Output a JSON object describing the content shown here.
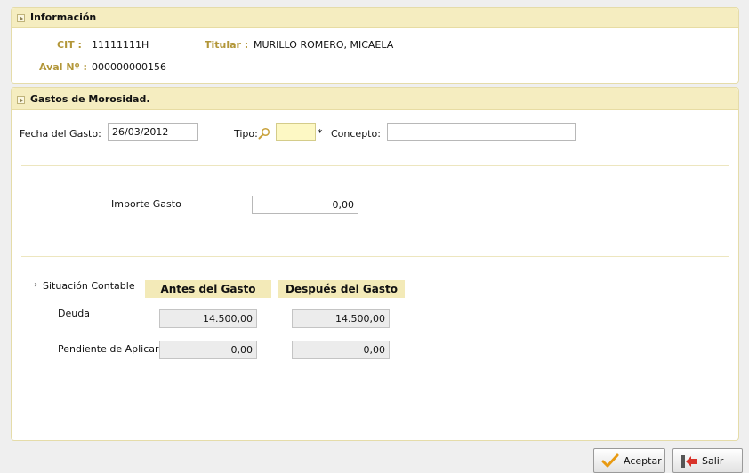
{
  "informacion": {
    "title": "Información",
    "cit_label": "CIT :",
    "cit_value": "11111111H",
    "titular_label": "Titular :",
    "titular_value": "MURILLO ROMERO, MICAELA",
    "aval_label": "Aval Nº :",
    "aval_value": "000000000156"
  },
  "gastos": {
    "title": "Gastos de Morosidad.",
    "fecha_label": "Fecha del Gasto:",
    "fecha_value": "26/03/2012",
    "tipo_label": "Tipo:",
    "tipo_value": "",
    "required_mark": "*",
    "concepto_label": "Concepto:",
    "concepto_value": "",
    "importe_label": "Importe Gasto",
    "importe_value": "0,00"
  },
  "situacion": {
    "label": "Situación Contable",
    "bullet": "›",
    "col_antes": "Antes del Gasto",
    "col_despues": "Después del Gasto",
    "rows": [
      {
        "label": "Deuda",
        "antes": "14.500,00",
        "despues": "14.500,00"
      },
      {
        "label": "Pendiente de Aplicar",
        "antes": "0,00",
        "despues": "0,00"
      }
    ]
  },
  "buttons": {
    "aceptar": "Aceptar",
    "salir": "Salir"
  },
  "colors": {
    "panel_header": "#f5edc0",
    "label_gold": "#b29638",
    "required_field": "#fdf8c4"
  }
}
